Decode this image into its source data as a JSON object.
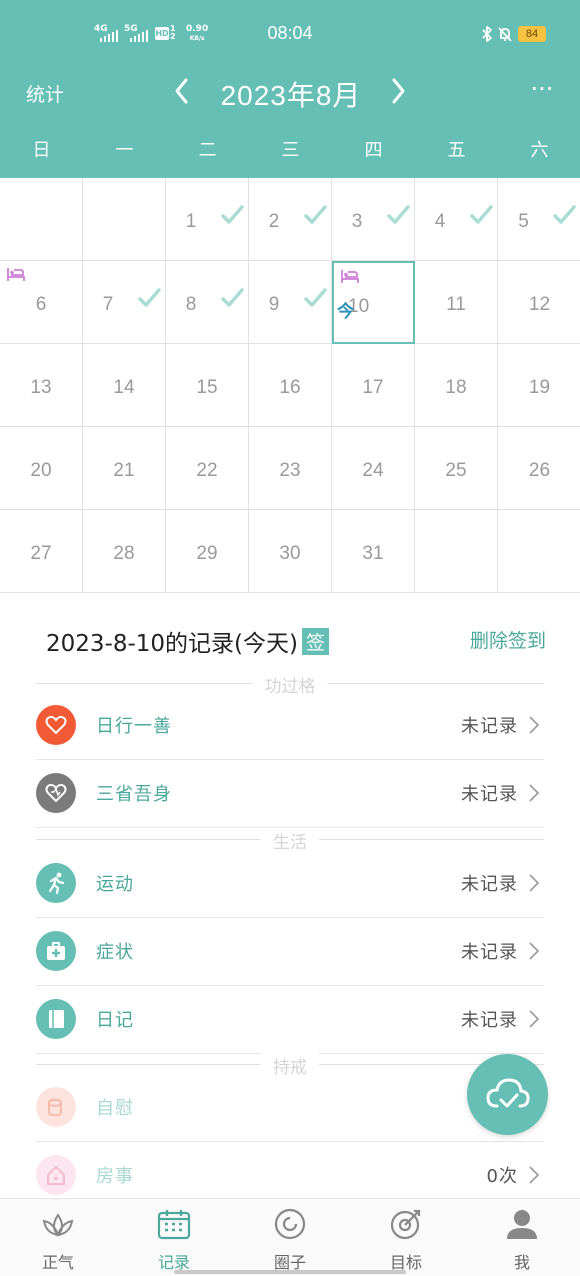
{
  "status_bar": {
    "net1": "4G",
    "net2": "5G",
    "hd": "HD",
    "hd_sub": "1\n2",
    "speed_value": "0.90",
    "speed_unit": "KB/s",
    "time": "08:04",
    "battery": "84"
  },
  "header": {
    "stats_label": "统计",
    "month_title": "2023年8月",
    "more_label": "···"
  },
  "weekdays": [
    "日",
    "一",
    "二",
    "三",
    "四",
    "五",
    "六"
  ],
  "calendar": {
    "today_tag": "今",
    "days": [
      {
        "d": "",
        "checked": false
      },
      {
        "d": "",
        "checked": false
      },
      {
        "d": "1",
        "checked": true
      },
      {
        "d": "2",
        "checked": true
      },
      {
        "d": "3",
        "checked": true
      },
      {
        "d": "4",
        "checked": true
      },
      {
        "d": "5",
        "checked": true
      },
      {
        "d": "6",
        "checked": false,
        "flag": true
      },
      {
        "d": "7",
        "checked": true
      },
      {
        "d": "8",
        "checked": true
      },
      {
        "d": "9",
        "checked": true
      },
      {
        "d": "10",
        "checked": false,
        "flag": true,
        "today": true
      },
      {
        "d": "11",
        "checked": false
      },
      {
        "d": "12",
        "checked": false
      },
      {
        "d": "13",
        "checked": false
      },
      {
        "d": "14",
        "checked": false
      },
      {
        "d": "15",
        "checked": false
      },
      {
        "d": "16",
        "checked": false
      },
      {
        "d": "17",
        "checked": false
      },
      {
        "d": "18",
        "checked": false
      },
      {
        "d": "19",
        "checked": false
      },
      {
        "d": "20",
        "checked": false
      },
      {
        "d": "21",
        "checked": false
      },
      {
        "d": "22",
        "checked": false
      },
      {
        "d": "23",
        "checked": false
      },
      {
        "d": "24",
        "checked": false
      },
      {
        "d": "25",
        "checked": false
      },
      {
        "d": "26",
        "checked": false
      },
      {
        "d": "27",
        "checked": false
      },
      {
        "d": "28",
        "checked": false
      },
      {
        "d": "29",
        "checked": false
      },
      {
        "d": "30",
        "checked": false
      },
      {
        "d": "31",
        "checked": false
      },
      {
        "d": "",
        "checked": false
      },
      {
        "d": "",
        "checked": false
      }
    ]
  },
  "record": {
    "title": "2023-8-10的记录(今天)",
    "sign_badge": "签",
    "delete_label": "删除签到"
  },
  "sections": {
    "merit": "功过格",
    "life": "生活",
    "precepts": "持戒"
  },
  "rows": {
    "good_deed": {
      "label": "日行一善",
      "status": "未记录"
    },
    "reflect": {
      "label": "三省吾身",
      "status": "未记录"
    },
    "exercise": {
      "label": "运动",
      "status": "未记录"
    },
    "symptom": {
      "label": "症状",
      "status": "未记录"
    },
    "diary": {
      "label": "日记",
      "status": "未记录"
    },
    "selfcomfort": {
      "label": "自慰",
      "status": ""
    },
    "intimacy": {
      "label": "房事",
      "status": "0次"
    }
  },
  "colors": {
    "accent": "#65bfb4",
    "accent_dark": "#4aa79b",
    "heart_red": "#f15a35",
    "heart_gray": "#7b7b7b"
  },
  "tabs": [
    {
      "label": "正气",
      "icon": "lotus-icon"
    },
    {
      "label": "记录",
      "icon": "calendar-icon",
      "active": true
    },
    {
      "label": "圈子",
      "icon": "circle-icon"
    },
    {
      "label": "目标",
      "icon": "target-icon"
    },
    {
      "label": "我",
      "icon": "person-icon"
    }
  ]
}
